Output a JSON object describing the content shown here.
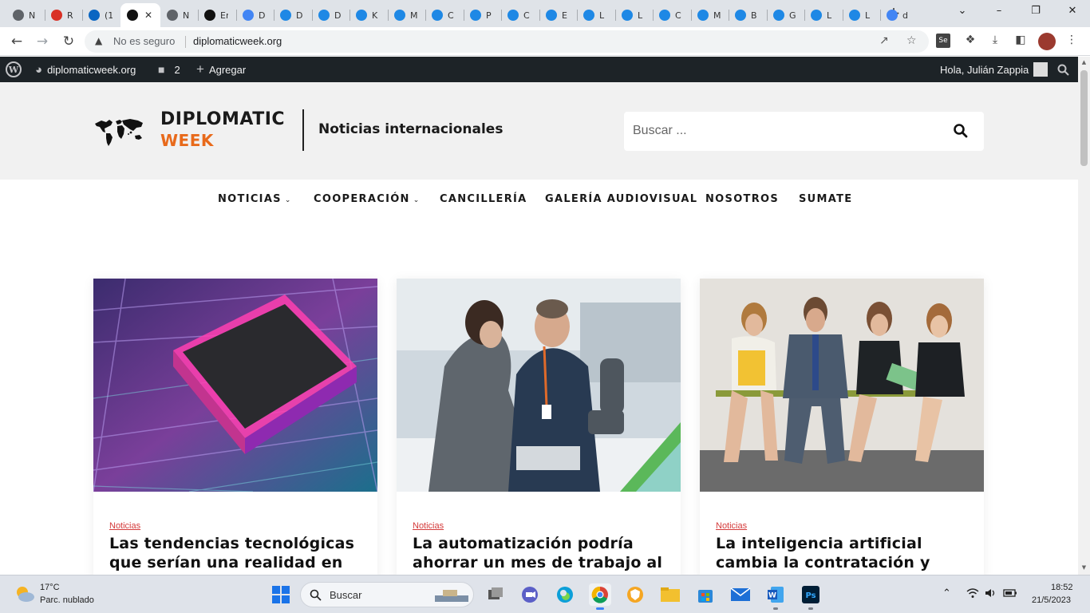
{
  "browser": {
    "tabs": [
      {
        "title": "N",
        "icon": "chrome-icon",
        "color": "#5f6368"
      },
      {
        "title": "R",
        "icon": "gmail-icon",
        "color": "#d93025"
      },
      {
        "title": "(1",
        "icon": "linkedin-icon",
        "color": "#0a66c2"
      },
      {
        "title": "",
        "icon": "diplomaticweek-icon",
        "color": "#111111",
        "active": true
      },
      {
        "title": "N",
        "icon": "chrome-icon",
        "color": "#5f6368"
      },
      {
        "title": "Er",
        "icon": "diplomaticweek-icon",
        "color": "#111111"
      },
      {
        "title": "D",
        "icon": "google-icon",
        "color": "#4285f4"
      },
      {
        "title": "D",
        "icon": "u-icon",
        "color": "#1e88e5"
      },
      {
        "title": "D",
        "icon": "u-icon",
        "color": "#1e88e5"
      },
      {
        "title": "K",
        "icon": "u-icon",
        "color": "#1e88e5"
      },
      {
        "title": "M",
        "icon": "u-icon",
        "color": "#1e88e5"
      },
      {
        "title": "C",
        "icon": "u-icon",
        "color": "#1e88e5"
      },
      {
        "title": "P",
        "icon": "u-icon",
        "color": "#1e88e5"
      },
      {
        "title": "C",
        "icon": "u-icon",
        "color": "#1e88e5"
      },
      {
        "title": "E",
        "icon": "u-icon",
        "color": "#1e88e5"
      },
      {
        "title": "L",
        "icon": "u-icon",
        "color": "#1e88e5"
      },
      {
        "title": "L",
        "icon": "u-icon",
        "color": "#1e88e5"
      },
      {
        "title": "C",
        "icon": "u-icon",
        "color": "#1e88e5"
      },
      {
        "title": "M",
        "icon": "u-icon",
        "color": "#1e88e5"
      },
      {
        "title": "B",
        "icon": "u-icon",
        "color": "#1e88e5"
      },
      {
        "title": "G",
        "icon": "u-icon",
        "color": "#1e88e5"
      },
      {
        "title": "L",
        "icon": "u-icon",
        "color": "#1e88e5"
      },
      {
        "title": "L",
        "icon": "u-icon",
        "color": "#1e88e5"
      },
      {
        "title": "d",
        "icon": "google-icon",
        "color": "#4285f4"
      }
    ],
    "security_label": "No es seguro",
    "url": "diplomaticweek.org"
  },
  "adminbar": {
    "site_name": "diplomaticweek.org",
    "comments_count": "2",
    "new_label": "Agregar",
    "greeting": "Hola, Julián Zappia"
  },
  "header": {
    "logo_line1": "DIPLOMATIC",
    "logo_line2": "WEEK",
    "tagline": "Noticias internacionales",
    "search_placeholder": "Buscar ...",
    "accent_color": "#e86a1b"
  },
  "nav": {
    "items": [
      {
        "label": "NOTICIAS",
        "caret": true
      },
      {
        "label": "COOPERACIÓN",
        "caret": true
      },
      {
        "label": "CANCILLERÍA",
        "caret": false
      },
      {
        "label": "GALERÍA AUDIOVISUAL",
        "caret": false
      },
      {
        "label": "NOSOTROS",
        "caret": false
      },
      {
        "label": "SUMATE",
        "caret": false
      }
    ]
  },
  "posts": [
    {
      "category": "Noticias",
      "title": "Las tendencias tecnológicas que serían una realidad en los"
    },
    {
      "category": "Noticias",
      "title": "La automatización podría ahorrar un mes de trabajo al"
    },
    {
      "category": "Noticias",
      "title": "La inteligencia artificial cambia la contratación y"
    }
  ],
  "taskbar": {
    "weather_temp": "17°C",
    "weather_desc": "Parc. nublado",
    "search_label": "Buscar",
    "time": "18:52",
    "date": "21/5/2023"
  }
}
